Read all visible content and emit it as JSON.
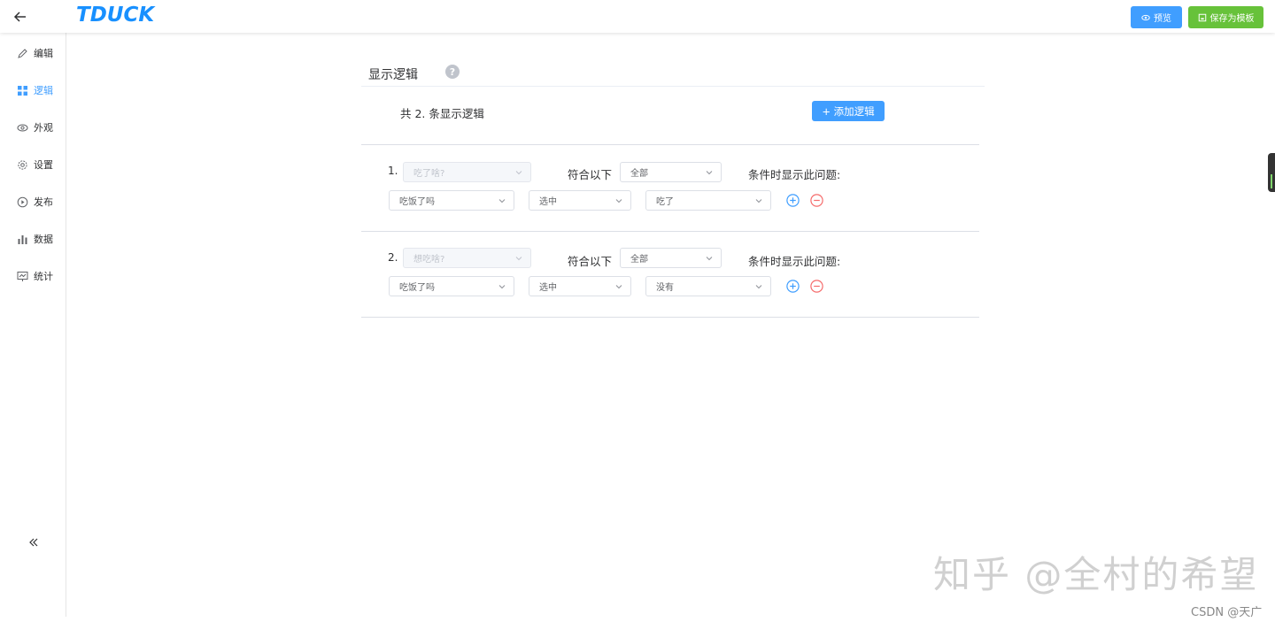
{
  "app": {
    "logo": "TDUCK"
  },
  "toolbar": {
    "preview_label": "预览",
    "save_template_label": "保存为模板"
  },
  "sidebar": {
    "items": [
      {
        "label": "编辑",
        "icon": "edit-icon"
      },
      {
        "label": "逻辑",
        "icon": "logic-grid-icon",
        "active": true
      },
      {
        "label": "外观",
        "icon": "eye-icon"
      },
      {
        "label": "设置",
        "icon": "gear-icon"
      },
      {
        "label": "发布",
        "icon": "play-circle-icon"
      },
      {
        "label": "数据",
        "icon": "bar-chart-icon"
      },
      {
        "label": "统计",
        "icon": "stats-icon"
      }
    ]
  },
  "main": {
    "title": "显示逻辑",
    "help": "?",
    "total_text": "共 2. 条显示逻辑",
    "add_button": "+ 添加逻辑",
    "match_label": "符合以下",
    "condition_label": "条件时显示此问题:",
    "logic_items": [
      {
        "number": "1.",
        "question": "吃了啥?",
        "match": "全部",
        "condition": {
          "field": "吃饭了吗",
          "operator": "选中",
          "value": "吃了"
        }
      },
      {
        "number": "2.",
        "question": "想吃啥?",
        "match": "全部",
        "condition": {
          "field": "吃饭了吗",
          "operator": "选中",
          "value": "没有"
        }
      }
    ]
  },
  "watermark": "知乎 @全村的希望",
  "credit": "CSDN @天广",
  "colors": {
    "primary": "#409eff",
    "success": "#67c23a",
    "danger": "#f56c6c"
  }
}
